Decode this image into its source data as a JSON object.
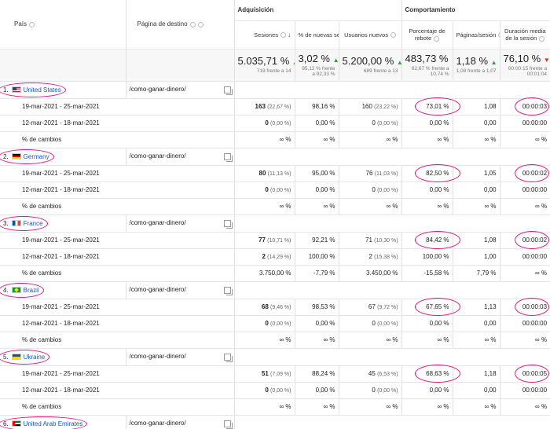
{
  "header": {
    "col_country": "País",
    "col_landing": "Página de destino",
    "group_acquisition": "Adquisición",
    "group_behavior": "Comportamiento",
    "col_sessions": "Sesiones",
    "col_new_sessions_pct": "% de nuevas sesiones",
    "col_new_users": "Usuarios nuevos",
    "col_bounce_rate": "Porcentaje de rebote",
    "col_pages_session": "Páginas/sesión",
    "col_avg_duration": "Duración media de la sesión"
  },
  "totals": {
    "sessions": "5.035,71 %",
    "sessions_sub": "719 frente a 14",
    "new_sessions_pct": "3,02 %",
    "new_sessions_pct_sub": "95,12 % frente a 92,33 %",
    "new_users": "5.200,00 %",
    "new_users_sub": "689 frente a 13",
    "bounce_rate": "483,73 %",
    "bounce_rate_sub": "62,67 % frente a 10,74 %",
    "pages_session": "1,18 %",
    "pages_session_sub": "1,08 frente a 1,07",
    "avg_duration": "76,10 %",
    "avg_duration_sub": "00:00:15 frente a 00:01:04"
  },
  "rows": [
    {
      "index": "1.",
      "country": "United States",
      "flag": "us",
      "landing": "/como-ganar-dinero/",
      "p1": {
        "label": "19-mar-2021 - 25-mar-2021",
        "sessions": "163",
        "sessions_pct": "(22,67 %)",
        "new_sessions_pct": "98,16 %",
        "new_users": "160",
        "new_users_pct": "(23,22 %)",
        "bounce": "73,01 %",
        "pages": "1,08",
        "duration": "00:00:03"
      },
      "p2": {
        "label": "12-mar-2021 - 18-mar-2021",
        "sessions": "0",
        "sessions_pct": "(0,00 %)",
        "new_sessions_pct": "0,00 %",
        "new_users": "0",
        "new_users_pct": "(0,00 %)",
        "bounce": "0,00 %",
        "pages": "0,00",
        "duration": "00:00:00"
      },
      "chg": {
        "label": "% de cambios",
        "sessions": "∞ %",
        "new_sessions_pct": "∞ %",
        "new_users": "∞ %",
        "bounce": "∞ %",
        "pages": "∞ %",
        "duration": "∞ %"
      }
    },
    {
      "index": "2.",
      "country": "Germany",
      "flag": "de",
      "landing": "/como-ganar-dinero/",
      "p1": {
        "label": "19-mar-2021 - 25-mar-2021",
        "sessions": "80",
        "sessions_pct": "(11,13 %)",
        "new_sessions_pct": "95,00 %",
        "new_users": "76",
        "new_users_pct": "(11,03 %)",
        "bounce": "82,50 %",
        "pages": "1,05",
        "duration": "00:00:02"
      },
      "p2": {
        "label": "12-mar-2021 - 18-mar-2021",
        "sessions": "0",
        "sessions_pct": "(0,00 %)",
        "new_sessions_pct": "0,00 %",
        "new_users": "0",
        "new_users_pct": "(0,00 %)",
        "bounce": "0,00 %",
        "pages": "0,00",
        "duration": "00:00:00"
      },
      "chg": {
        "label": "% de cambios",
        "sessions": "∞ %",
        "new_sessions_pct": "∞ %",
        "new_users": "∞ %",
        "bounce": "∞ %",
        "pages": "∞ %",
        "duration": "∞ %"
      }
    },
    {
      "index": "3.",
      "country": "France",
      "flag": "fr",
      "landing": "/como-ganar-dinero/",
      "p1": {
        "label": "19-mar-2021 - 25-mar-2021",
        "sessions": "77",
        "sessions_pct": "(10,71 %)",
        "new_sessions_pct": "92,21 %",
        "new_users": "71",
        "new_users_pct": "(10,30 %)",
        "bounce": "84,42 %",
        "pages": "1,08",
        "duration": "00:00:02"
      },
      "p2": {
        "label": "12-mar-2021 - 18-mar-2021",
        "sessions": "2",
        "sessions_pct": "(14,29 %)",
        "new_sessions_pct": "100,00 %",
        "new_users": "2",
        "new_users_pct": "(15,38 %)",
        "bounce": "100,00 %",
        "pages": "1,00",
        "duration": "00:00:00"
      },
      "chg": {
        "label": "% de cambios",
        "sessions": "3.750,00 %",
        "new_sessions_pct": "-7,79 %",
        "new_users": "3.450,00 %",
        "bounce": "-15,58 %",
        "pages": "7,79 %",
        "duration": "∞ %"
      }
    },
    {
      "index": "4.",
      "country": "Brazil",
      "flag": "br",
      "landing": "/como-ganar-dinero/",
      "p1": {
        "label": "19-mar-2021 - 25-mar-2021",
        "sessions": "68",
        "sessions_pct": "(9,46 %)",
        "new_sessions_pct": "98,53 %",
        "new_users": "67",
        "new_users_pct": "(9,72 %)",
        "bounce": "67,65 %",
        "pages": "1,13",
        "duration": "00:00:03"
      },
      "p2": {
        "label": "12-mar-2021 - 18-mar-2021",
        "sessions": "0",
        "sessions_pct": "(0,00 %)",
        "new_sessions_pct": "0,00 %",
        "new_users": "0",
        "new_users_pct": "(0,00 %)",
        "bounce": "0,00 %",
        "pages": "0,00",
        "duration": "00:00:00"
      },
      "chg": {
        "label": "% de cambios",
        "sessions": "∞ %",
        "new_sessions_pct": "∞ %",
        "new_users": "∞ %",
        "bounce": "∞ %",
        "pages": "∞ %",
        "duration": "∞ %"
      }
    },
    {
      "index": "5.",
      "country": "Ukraine",
      "flag": "ua",
      "landing": "/como-ganar-dinero/",
      "p1": {
        "label": "19-mar-2021 - 25-mar-2021",
        "sessions": "51",
        "sessions_pct": "(7,09 %)",
        "new_sessions_pct": "88,24 %",
        "new_users": "45",
        "new_users_pct": "(6,53 %)",
        "bounce": "68,63 %",
        "pages": "1,18",
        "duration": "00:00:05"
      },
      "p2": {
        "label": "12-mar-2021 - 18-mar-2021",
        "sessions": "0",
        "sessions_pct": "(0,00 %)",
        "new_sessions_pct": "0,00 %",
        "new_users": "0",
        "new_users_pct": "(0,00 %)",
        "bounce": "0,00 %",
        "pages": "0,00",
        "duration": "00:00:00"
      },
      "chg": {
        "label": "% de cambios",
        "sessions": "∞ %",
        "new_sessions_pct": "∞ %",
        "new_users": "∞ %",
        "bounce": "∞ %",
        "pages": "∞ %",
        "duration": "∞ %"
      }
    }
  ],
  "last_row": {
    "index": "6.",
    "country": "United Arab Emirates",
    "flag": "ae",
    "landing": "/como-ganar-dinero/"
  },
  "colors": {
    "accent_link": "#1a55b8",
    "annotation": "#e0147f",
    "up": "#2e9d3a",
    "down": "#d52f35"
  }
}
